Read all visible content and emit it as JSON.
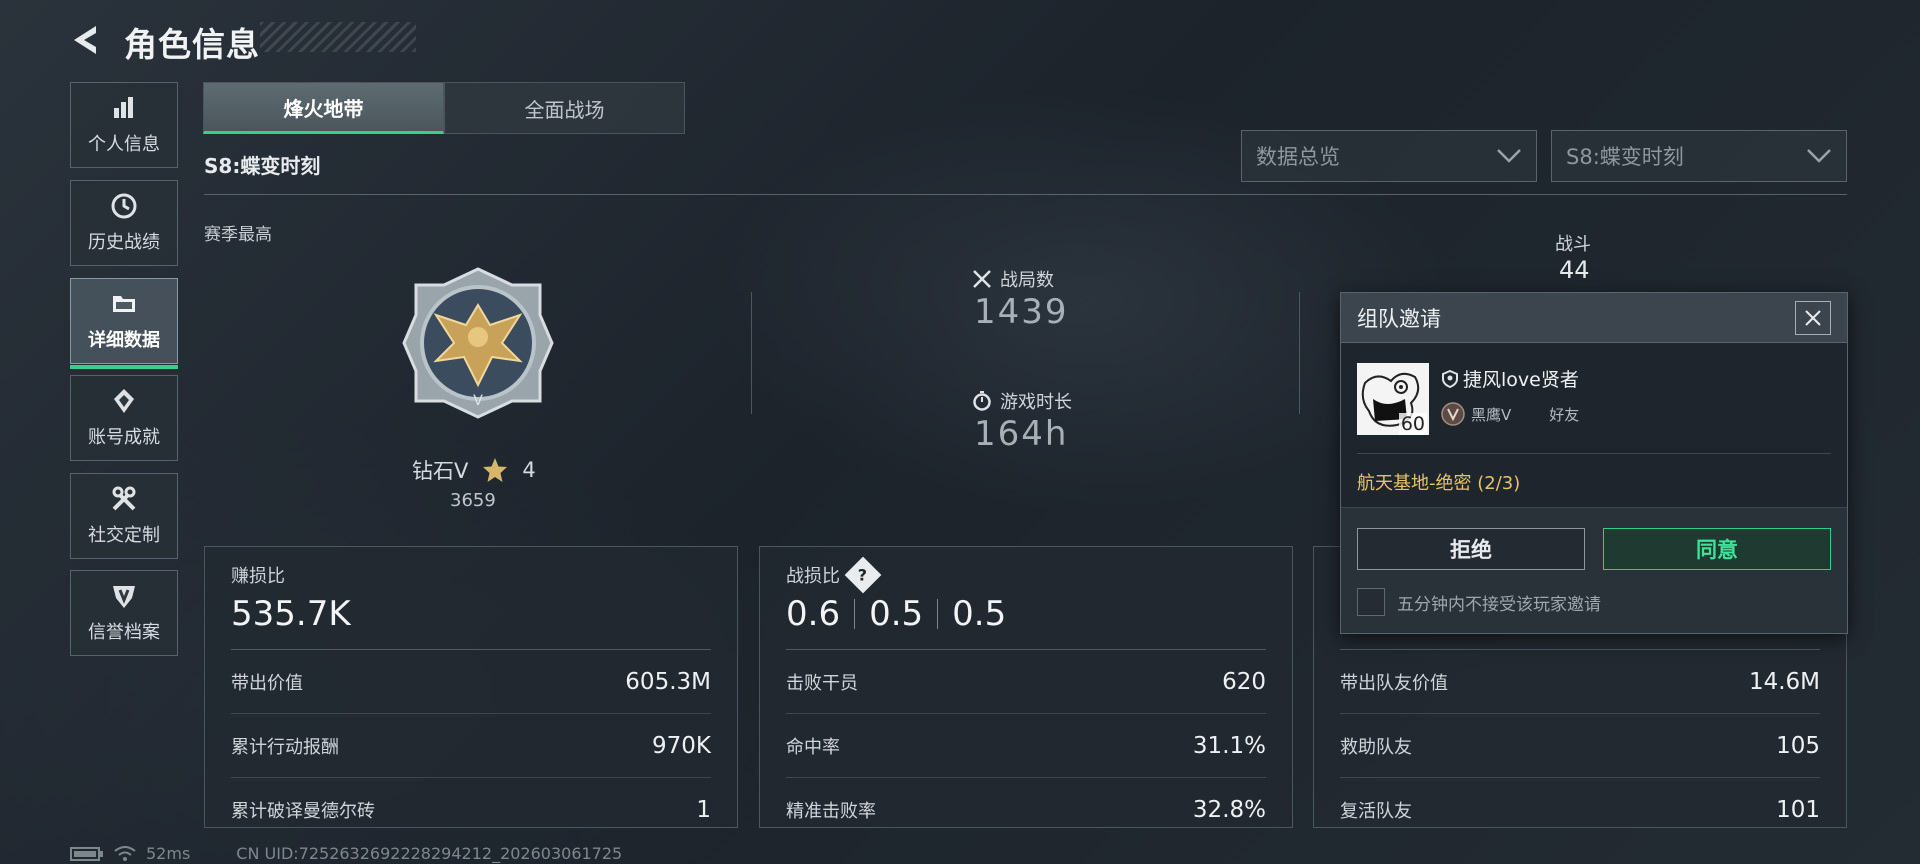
{
  "header": {
    "title": "角色信息"
  },
  "sidebar": {
    "items": [
      {
        "label": "个人信息",
        "icon": "bar-chart-icon"
      },
      {
        "label": "历史战绩",
        "icon": "history-clock-icon"
      },
      {
        "label": "详细数据",
        "icon": "folder-icon",
        "active": true
      },
      {
        "label": "账号成就",
        "icon": "achievement-icon"
      },
      {
        "label": "社交定制",
        "icon": "tools-icon"
      },
      {
        "label": "信誉档案",
        "icon": "credit-shield-icon"
      }
    ]
  },
  "tabs": [
    {
      "label": "烽火地带",
      "active": true
    },
    {
      "label": "全面战场",
      "active": false
    }
  ],
  "season": "S8:蝶变时刻",
  "filters": {
    "overview": "数据总览",
    "season": "S8:蝶变时刻"
  },
  "season_best": {
    "label": "赛季最高",
    "rank": "钻石V",
    "stars": "4",
    "score": "3659"
  },
  "stats": {
    "matches": {
      "label": "战局数",
      "value": "1439"
    },
    "playtime": {
      "label": "游戏时长",
      "value": "164h"
    },
    "combat": {
      "label": "战斗",
      "value": "44"
    }
  },
  "cards": [
    {
      "head_label": "赚损比",
      "head_value": "535.7K",
      "rows": [
        {
          "label": "带出价值",
          "value": "605.3M"
        },
        {
          "label": "累计行动报酬",
          "value": "970K"
        },
        {
          "label": "累计破译曼德尔砖",
          "value": "1"
        }
      ]
    },
    {
      "head_label": "战损比",
      "help": "?",
      "ratios": [
        "0.6",
        "0.5",
        "0.5"
      ],
      "rows": [
        {
          "label": "击败干员",
          "value": "620"
        },
        {
          "label": "命中率",
          "value": "31.1%"
        },
        {
          "label": "精准击败率",
          "value": "32.8%"
        }
      ]
    },
    {
      "rows": [
        {
          "label": "带出队友价值",
          "value": "14.6M"
        },
        {
          "label": "救助队友",
          "value": "105"
        },
        {
          "label": "复活队友",
          "value": "101"
        }
      ]
    }
  ],
  "footer": {
    "ping": "52ms",
    "uid": "CN UID:7252632692228294212_202603061725"
  },
  "modal": {
    "title": "组队邀请",
    "inviter": {
      "name": "捷风love贤者",
      "level": "60",
      "rank": "黑鹰V",
      "relation": "好友"
    },
    "mode": "航天基地-绝密 (2/3)",
    "reject": "拒绝",
    "accept": "同意",
    "no_invite": "五分钟内不接受该玩家邀请"
  },
  "colors": {
    "accent": "#35d08a",
    "gold": "#e6c36a"
  }
}
